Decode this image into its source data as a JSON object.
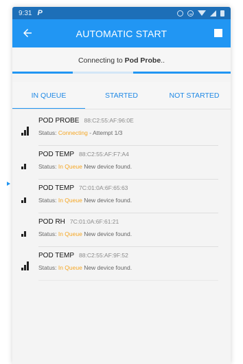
{
  "status_bar": {
    "time": "9:31",
    "app_glyph": "P"
  },
  "appbar": {
    "title": "AUTOMATIC START"
  },
  "connection": {
    "prefix": "Connecting to ",
    "device": "Pod Probe",
    "suffix": ".."
  },
  "tabs": [
    {
      "label": "IN QUEUE",
      "active": true
    },
    {
      "label": "STARTED",
      "active": false
    },
    {
      "label": "NOT STARTED",
      "active": false
    }
  ],
  "devices": [
    {
      "name": "POD PROBE",
      "mac": "88:C2:55:AF:96:0E",
      "status_label": "Status:",
      "status": "Connecting",
      "detail": " - Attempt 1/3",
      "signal": 3
    },
    {
      "name": "POD TEMP",
      "mac": "88:C2:55:AF:F7:A4",
      "status_label": "Status:",
      "status": "In Queue",
      "detail": " New device found.",
      "signal": 2
    },
    {
      "name": "POD TEMP",
      "mac": "7C:01:0A:6F:65:63",
      "status_label": "Status:",
      "status": "In Queue",
      "detail": " New device found.",
      "signal": 2
    },
    {
      "name": "POD RH",
      "mac": "7C:01:0A:6F:61:21",
      "status_label": "Status:",
      "status": "In Queue",
      "detail": " New device found.",
      "signal": 2
    },
    {
      "name": "POD TEMP",
      "mac": "88:C2:55:AF:9F:52",
      "status_label": "Status:",
      "status": "In Queue",
      "detail": " New device found.",
      "signal": 3
    }
  ],
  "colors": {
    "primary": "#2196f3",
    "status_bar": "#1d6fb8",
    "status_highlight": "#f5a623"
  }
}
